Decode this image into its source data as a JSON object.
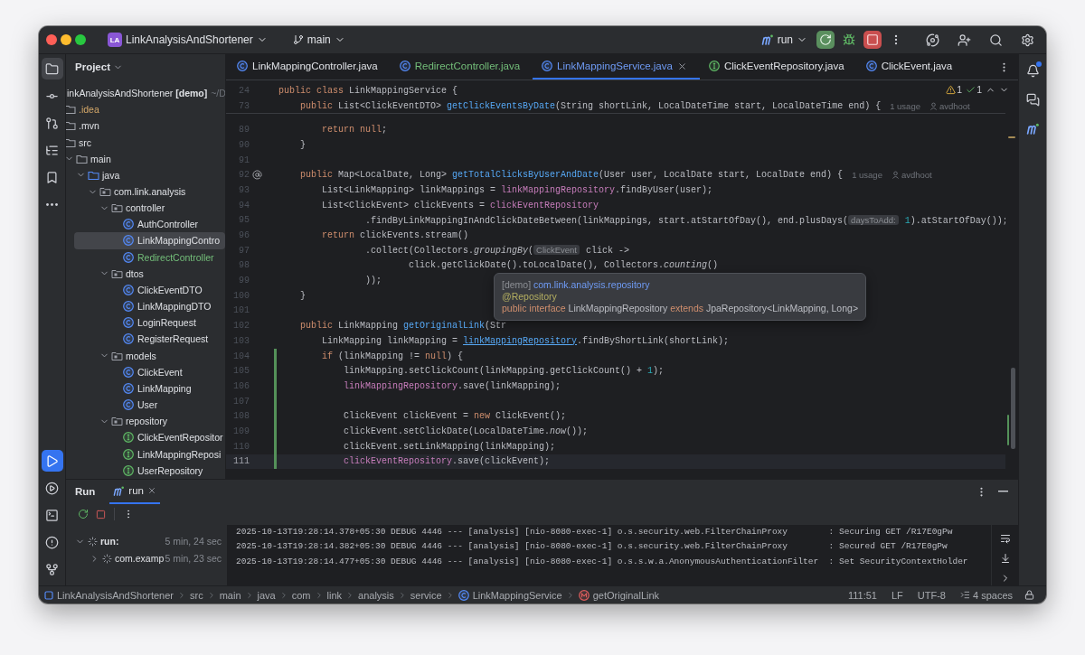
{
  "title_bar": {
    "project_badge": "LA",
    "project": "LinkAnalysisAndShortener",
    "branch": "main",
    "run_config": "run"
  },
  "project_panel": {
    "title": "Project",
    "tree": [
      {
        "label": "inkAnalysisAndShortener **[demo]**",
        "path": "~/D",
        "selected": false,
        "children": [
          {
            "label": ".idea",
            "kind": "folder",
            "color": "#d5a869",
            "selected": false
          },
          {
            "label": ".mvn",
            "kind": "folder",
            "selected": false
          },
          {
            "label": "src",
            "kind": "folder",
            "selected": false,
            "children": [
              {
                "label": "main",
                "kind": "folder",
                "selected": false,
                "expanded": true,
                "children": [
                  {
                    "label": "java",
                    "kind": "source",
                    "selected": false,
                    "expanded": true,
                    "children": [
                      {
                        "label": "com.link.analysis",
                        "kind": "package",
                        "selected": false,
                        "expanded": true,
                        "children": [
                          {
                            "label": "controller",
                            "kind": "package",
                            "selected": false,
                            "expanded": true,
                            "children": [
                              {
                                "label": "AuthController",
                                "kind": "class",
                                "selected": false
                              },
                              {
                                "label": "LinkMappingContro",
                                "kind": "class",
                                "selected": true
                              },
                              {
                                "label": "RedirectController",
                                "kind": "class",
                                "color": "#73bd79",
                                "selected": false
                              }
                            ]
                          },
                          {
                            "label": "dtos",
                            "kind": "package",
                            "selected": false,
                            "expanded": true,
                            "children": [
                              {
                                "label": "ClickEventDTO",
                                "kind": "class",
                                "selected": false
                              },
                              {
                                "label": "LinkMappingDTO",
                                "kind": "class",
                                "selected": false
                              },
                              {
                                "label": "LoginRequest",
                                "kind": "class",
                                "selected": false
                              },
                              {
                                "label": "RegisterRequest",
                                "kind": "class",
                                "selected": false
                              }
                            ]
                          },
                          {
                            "label": "models",
                            "kind": "package",
                            "selected": false,
                            "expanded": true,
                            "children": [
                              {
                                "label": "ClickEvent",
                                "kind": "class",
                                "selected": false
                              },
                              {
                                "label": "LinkMapping",
                                "kind": "class",
                                "selected": false
                              },
                              {
                                "label": "User",
                                "kind": "class",
                                "selected": false
                              }
                            ]
                          },
                          {
                            "label": "repository",
                            "kind": "package",
                            "selected": false,
                            "expanded": true,
                            "children": [
                              {
                                "label": "ClickEventRepositor",
                                "kind": "interface",
                                "selected": false
                              },
                              {
                                "label": "LinkMappingReposi",
                                "kind": "interface",
                                "selected": false
                              },
                              {
                                "label": "UserRepository",
                                "kind": "interface",
                                "selected": false
                              }
                            ]
                          }
                        ]
                      }
                    ]
                  }
                ]
              }
            ]
          }
        ]
      }
    ]
  },
  "editor": {
    "tabs": [
      {
        "label": "LinkMappingController.java",
        "kind": "class",
        "selected": false
      },
      {
        "label": "RedirectController.java",
        "kind": "class",
        "color": "#73bd79",
        "selected": false
      },
      {
        "label": "LinkMappingService.java",
        "kind": "class",
        "selected": true
      },
      {
        "label": "ClickEventRepository.java",
        "kind": "interface",
        "selected": false
      },
      {
        "label": "ClickEvent.java",
        "kind": "class",
        "selected": false
      }
    ],
    "inspections": {
      "warnings": "1",
      "weak_warnings": "1"
    },
    "sticky_lines": [
      {
        "number": "24",
        "tokens": [
          {
            "text": "public class ",
            "kind": "keyword"
          },
          {
            "text": "LinkMappingService {",
            "kind": "plain"
          }
        ]
      },
      {
        "number": "73",
        "tokens": [
          {
            "text": "    public ",
            "kind": "keyword"
          },
          {
            "text": "List<ClickEventDTO> ",
            "kind": "plain"
          },
          {
            "text": "getClickEventsByDate",
            "kind": "method"
          },
          {
            "text": "(String shortLink, LocalDateTime start, LocalDateTime end) {",
            "kind": "plain"
          }
        ],
        "usages": "1 usage",
        "author": "avdhoot"
      }
    ],
    "lines": [
      {
        "number": "89",
        "kind": "plain",
        "changed": false,
        "selected": false,
        "tokens": [
          {
            "text": "        return ",
            "kind": "keyword"
          },
          {
            "text": "null",
            "kind": "keyword"
          },
          {
            "text": ";",
            "kind": "plain"
          }
        ]
      },
      {
        "number": "90",
        "kind": "plain",
        "changed": false,
        "selected": false,
        "tokens": [
          {
            "text": "    }",
            "kind": "plain"
          }
        ]
      },
      {
        "number": "91",
        "kind": "plain",
        "changed": false,
        "selected": false
      },
      {
        "number": "92",
        "kind": "annotated",
        "changed": false,
        "selected": false,
        "tokens": [
          {
            "text": "    public ",
            "kind": "keyword"
          },
          {
            "text": "Map<LocalDate, Long> ",
            "kind": "plain"
          },
          {
            "text": "getTotalClicksByUserAndDate",
            "kind": "method"
          },
          {
            "text": "(User user, LocalDate start, LocalDate end) {",
            "kind": "plain"
          }
        ],
        "usages": "1 usage",
        "author": "avdhoot"
      },
      {
        "number": "93",
        "kind": "plain",
        "changed": false,
        "selected": false,
        "tokens": [
          {
            "text": "        List<LinkMapping> linkMappings = ",
            "kind": "plain"
          },
          {
            "text": "linkMappingRepository",
            "kind": "field"
          },
          {
            "text": ".findByUser(user);",
            "kind": "plain"
          }
        ]
      },
      {
        "number": "94",
        "kind": "plain",
        "changed": false,
        "selected": false,
        "tokens": [
          {
            "text": "        List<ClickEvent> clickEvents = ",
            "kind": "plain"
          },
          {
            "text": "clickEventRepository",
            "kind": "field"
          }
        ]
      },
      {
        "number": "95",
        "kind": "plain",
        "changed": false,
        "selected": false,
        "tokens": [
          {
            "text": "                .findByLinkMappingInAndClickDateBetween(linkMappings, start.atStartOfDay(), end.plusDays(",
            "kind": "plain"
          },
          {
            "text": "daysToAdd:",
            "kind": "hint"
          },
          {
            "text": " 1",
            "kind": "number"
          },
          {
            "text": ").atStartOfDay());",
            "kind": "plain"
          }
        ]
      },
      {
        "number": "96",
        "kind": "plain",
        "changed": false,
        "selected": false,
        "tokens": [
          {
            "text": "        return",
            "kind": "keyword"
          },
          {
            "text": " clickEvents.stream()",
            "kind": "plain"
          }
        ]
      },
      {
        "number": "97",
        "kind": "plain",
        "changed": false,
        "selected": false,
        "tokens": [
          {
            "text": "                .collect(Collectors.",
            "kind": "plain"
          },
          {
            "text": "groupingBy",
            "kind": "static"
          },
          {
            "text": "(",
            "kind": "plain"
          },
          {
            "text": "ClickEvent",
            "kind": "hint"
          },
          {
            "text": " click ->",
            "kind": "plain"
          }
        ]
      },
      {
        "number": "98",
        "kind": "plain",
        "changed": false,
        "selected": false,
        "tokens": [
          {
            "text": "                        click.getClickDate().toLocalDate(), Collectors.",
            "kind": "plain"
          },
          {
            "text": "counting",
            "kind": "static"
          },
          {
            "text": "()",
            "kind": "plain"
          }
        ]
      },
      {
        "number": "99",
        "kind": "plain",
        "changed": false,
        "selected": false,
        "tokens": [
          {
            "text": "                ));",
            "kind": "plain"
          }
        ]
      },
      {
        "number": "100",
        "kind": "plain",
        "changed": false,
        "selected": false,
        "tokens": [
          {
            "text": "    }",
            "kind": "plain"
          }
        ]
      },
      {
        "number": "101",
        "kind": "plain",
        "changed": false,
        "selected": false
      },
      {
        "number": "102",
        "kind": "plain",
        "changed": false,
        "selected": false,
        "tokens": [
          {
            "text": "    public ",
            "kind": "keyword"
          },
          {
            "text": "LinkMapping ",
            "kind": "plain"
          },
          {
            "text": "getOriginalLink",
            "kind": "method"
          },
          {
            "text": "(Str",
            "kind": "plain"
          }
        ]
      },
      {
        "number": "103",
        "kind": "plain",
        "changed": false,
        "selected": false,
        "tokens": [
          {
            "text": "        LinkMapping linkMapping = ",
            "kind": "plain"
          },
          {
            "text": "linkMappingRepository",
            "kind": "link"
          },
          {
            "text": ".findByShortLink(shortLink);",
            "kind": "plain"
          }
        ]
      },
      {
        "number": "104",
        "kind": "plain",
        "changed": true,
        "selected": false,
        "tokens": [
          {
            "text": "        if",
            "kind": "keyword"
          },
          {
            "text": " (linkMapping != ",
            "kind": "plain"
          },
          {
            "text": "null",
            "kind": "keyword"
          },
          {
            "text": ") {",
            "kind": "plain"
          }
        ]
      },
      {
        "number": "105",
        "kind": "plain",
        "changed": true,
        "selected": false,
        "tokens": [
          {
            "text": "            linkMapping.setClickCount(linkMapping.getClickCount() + ",
            "kind": "plain"
          },
          {
            "text": "1",
            "kind": "number"
          },
          {
            "text": ");",
            "kind": "plain"
          }
        ]
      },
      {
        "number": "106",
        "kind": "plain",
        "changed": true,
        "selected": false,
        "tokens": [
          {
            "text": "            linkMappingRepository",
            "kind": "field"
          },
          {
            "text": ".save(linkMapping);",
            "kind": "plain"
          }
        ]
      },
      {
        "number": "107",
        "kind": "plain",
        "changed": true,
        "selected": false
      },
      {
        "number": "108",
        "kind": "plain",
        "changed": true,
        "selected": false,
        "tokens": [
          {
            "text": "            ClickEvent clickEvent = ",
            "kind": "plain"
          },
          {
            "text": "new",
            "kind": "keyword"
          },
          {
            "text": " ClickEvent();",
            "kind": "plain"
          }
        ]
      },
      {
        "number": "109",
        "kind": "plain",
        "changed": true,
        "selected": false,
        "tokens": [
          {
            "text": "            clickEvent.setClickDate(LocalDateTime.",
            "kind": "plain"
          },
          {
            "text": "now",
            "kind": "static"
          },
          {
            "text": "());",
            "kind": "plain"
          }
        ]
      },
      {
        "number": "110",
        "kind": "plain",
        "changed": true,
        "selected": false,
        "tokens": [
          {
            "text": "            clickEvent.setLinkMapping(linkMapping);",
            "kind": "plain"
          }
        ]
      },
      {
        "number": "111",
        "kind": "plain",
        "changed": true,
        "selected": true,
        "tokens": [
          {
            "text": "            clickEventRepository",
            "kind": "field"
          },
          {
            "text": ".save(clickEvent);",
            "kind": "plain"
          }
        ]
      }
    ],
    "tooltip": [
      [
        {
          "text": "[demo] ",
          "kind": "muted"
        },
        {
          "text": "com.link.analysis.repository",
          "kind": "package"
        }
      ],
      [
        {
          "text": "@Repository",
          "kind": "annotation"
        }
      ],
      [
        {
          "text": "public interface ",
          "kind": "keyword"
        },
        {
          "text": "LinkMappingRepository ",
          "kind": "plain"
        },
        {
          "text": "extends ",
          "kind": "keyword"
        },
        {
          "text": "JpaRepository<LinkMapping, Long>",
          "kind": "plain"
        }
      ]
    ]
  },
  "run_panel": {
    "title": "Run",
    "tabs": [
      {
        "label": "run",
        "selected": true
      }
    ],
    "tree": [
      {
        "label": "run:",
        "time": "5 min, 24 sec",
        "expanded": true,
        "children": [
          {
            "label": "com.examp",
            "time": "5 min, 23 sec",
            "expanded": false
          }
        ]
      }
    ],
    "console": [
      "2025-10-13T19:28:14.378+05:30 DEBUG 4446 --- [analysis] [nio-8080-exec-1] o.s.security.web.FilterChainProxy        : Securing GET /R17E0gPw",
      "2025-10-13T19:28:14.382+05:30 DEBUG 4446 --- [analysis] [nio-8080-exec-1] o.s.security.web.FilterChainProxy        : Secured GET /R17E0gPw",
      "2025-10-13T19:28:14.477+05:30 DEBUG 4446 --- [analysis] [nio-8080-exec-1] o.s.s.w.a.AnonymousAuthenticationFilter  : Set SecurityContextHolder"
    ]
  },
  "status_bar": {
    "breadcrumbs": [
      {
        "label": "LinkAnalysisAndShortener",
        "kind": "module"
      },
      {
        "label": "src",
        "kind": "plain"
      },
      {
        "label": "main",
        "kind": "plain"
      },
      {
        "label": "java",
        "kind": "plain"
      },
      {
        "label": "com",
        "kind": "plain"
      },
      {
        "label": "link",
        "kind": "plain"
      },
      {
        "label": "analysis",
        "kind": "plain"
      },
      {
        "label": "service",
        "kind": "plain"
      },
      {
        "label": "LinkMappingService",
        "kind": "class"
      },
      {
        "label": "getOriginalLink",
        "kind": "method"
      }
    ],
    "position": "111:51",
    "line_separator": "LF",
    "encoding": "UTF-8",
    "indent": "4 spaces"
  }
}
